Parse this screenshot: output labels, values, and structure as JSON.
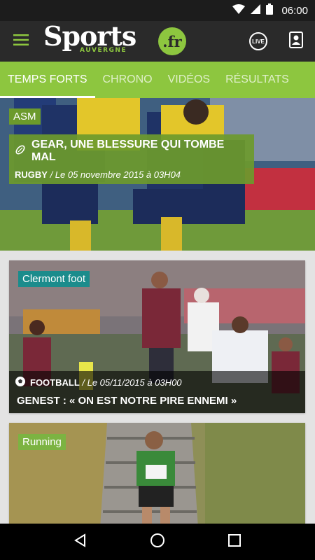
{
  "status_bar": {
    "time": "06:00"
  },
  "header": {
    "logo_word": "Sports",
    "logo_sub": "AUVERGNE",
    "logo_tld": ".fr",
    "live_label": "LIVE",
    "icons": {
      "menu": "hamburger-icon",
      "live": "live-icon",
      "account": "account-icon"
    }
  },
  "tabs": [
    {
      "label": "TEMPS FORTS",
      "active": true
    },
    {
      "label": "CHRONO",
      "active": false
    },
    {
      "label": "VIDÉOS",
      "active": false
    },
    {
      "label": "RÉSULTATS",
      "active": false
    }
  ],
  "feature": {
    "tag": "ASM",
    "title": "GEAR, UNE BLESSURE QUI TOMBE MAL",
    "sport": "RUGBY",
    "date": " / Le 05 novembre 2015 à 03H04",
    "icon": "rugby-ball-icon"
  },
  "articles": [
    {
      "tag": "Clermont foot",
      "sport": "FOOTBALL",
      "date": " / Le 05/11/2015 à 03H00",
      "title": "GENEST : « ON EST NOTRE PIRE ENNEMI »",
      "icon": "soccer-ball-icon"
    },
    {
      "tag": "Running"
    }
  ],
  "colors": {
    "brand_green": "#8dc63f",
    "header_dark": "#2a2a2a",
    "feature_overlay": "#6c9a2c",
    "clermont_tag": "#1b8c8c",
    "running_tag": "#7cb342"
  },
  "nav_bar": {
    "icons": [
      "back-icon",
      "home-icon",
      "recents-icon"
    ]
  }
}
